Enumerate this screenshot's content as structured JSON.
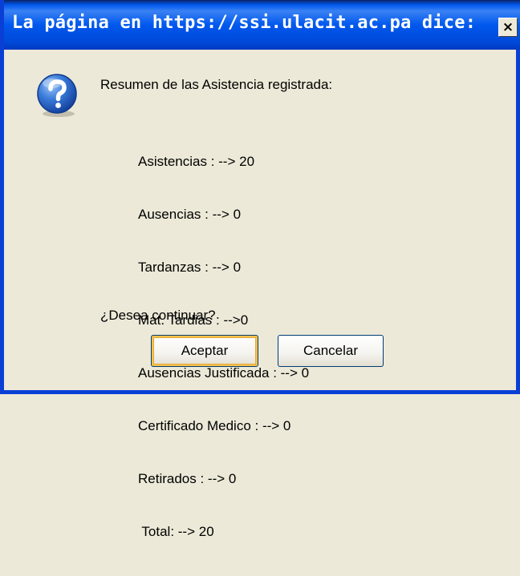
{
  "window": {
    "title": "La página en https://ssi.ulacit.ac.pa dice:",
    "close_label": "×"
  },
  "message": {
    "heading": "Resumen de las Asistencia registrada:",
    "lines": [
      "Asistencias : --> 20",
      "Ausencias : --> 0",
      "Tardanzas : --> 0",
      "Mat. Tardias : -->0",
      "Ausencias Justificada : --> 0",
      "Certificado Medico : --> 0",
      "Retirados : --> 0",
      " Total: --> 20"
    ],
    "question": "¿Desea continuar?"
  },
  "buttons": {
    "accept_label": "Aceptar",
    "cancel_label": "Cancelar"
  },
  "icons": {
    "dialog_icon": "question-icon",
    "close_icon": "close-icon"
  },
  "colors": {
    "titlebar": "#0058EE",
    "dialog_bg": "#ECE9D8",
    "icon_blue": "#1E5FC8"
  }
}
